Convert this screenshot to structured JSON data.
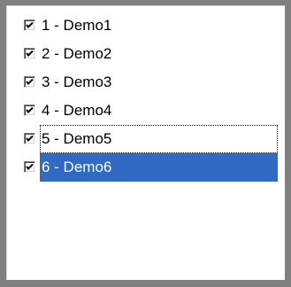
{
  "checklist": {
    "items": [
      {
        "label": "1 - Demo1",
        "checked": true,
        "state": "normal"
      },
      {
        "label": "2 - Demo2",
        "checked": true,
        "state": "normal"
      },
      {
        "label": "3 - Demo3",
        "checked": true,
        "state": "normal"
      },
      {
        "label": "4 - Demo4",
        "checked": true,
        "state": "normal"
      },
      {
        "label": "5 - Demo5",
        "checked": true,
        "state": "focused"
      },
      {
        "label": "6 - Demo6",
        "checked": true,
        "state": "selected"
      }
    ]
  },
  "colors": {
    "frame": "#808080",
    "list_background": "#ffffff",
    "selection_background": "#316ac5",
    "selection_text": "#ffffff",
    "check_mark": "#000000"
  }
}
